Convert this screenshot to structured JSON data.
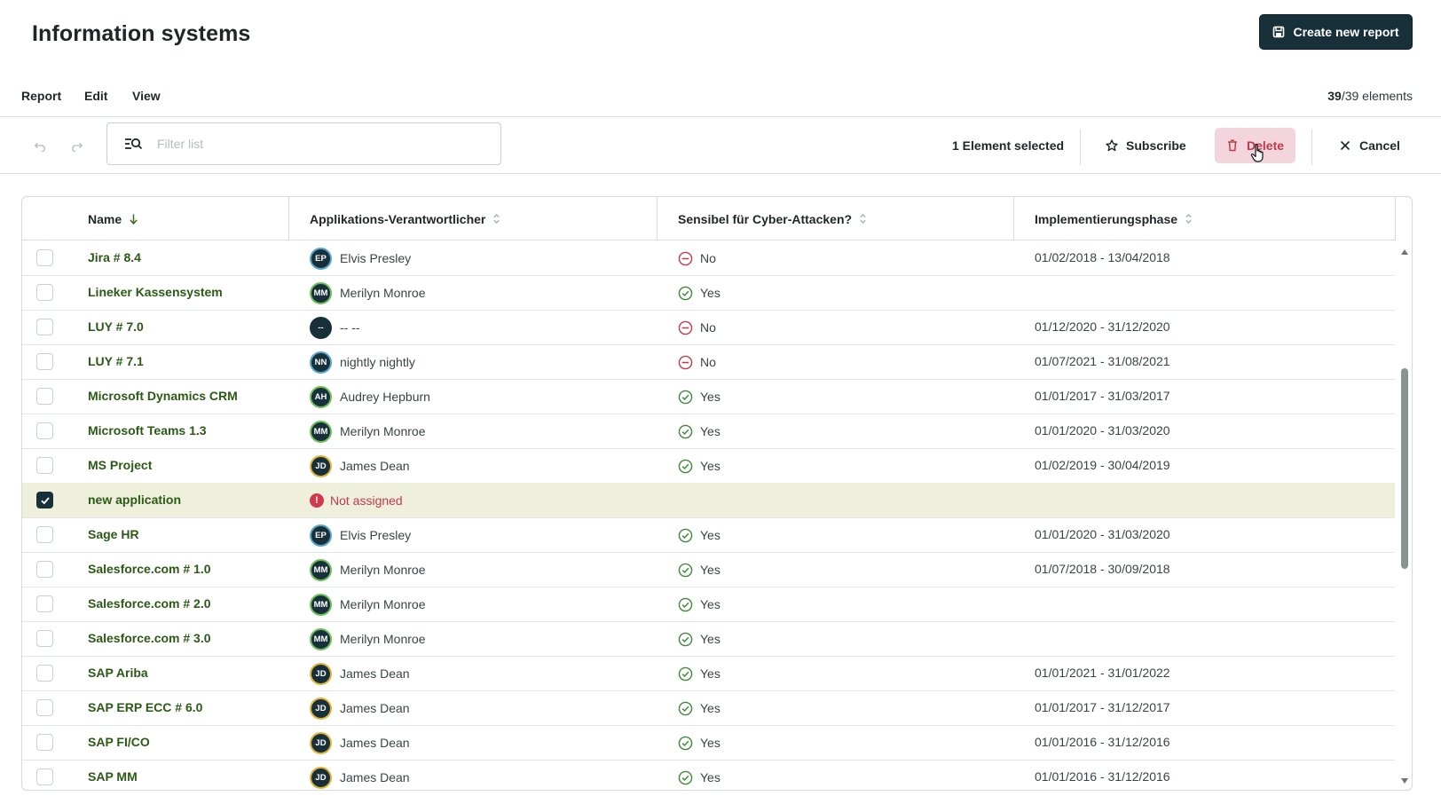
{
  "header": {
    "title": "Information systems",
    "create_label": "Create new report"
  },
  "menu": {
    "report": "Report",
    "edit": "Edit",
    "view": "View",
    "count_shown": "39",
    "count_total": "/39 elements"
  },
  "toolbar": {
    "filter_placeholder": "Filter list",
    "filter_value": "",
    "selection_text": "1 Element selected",
    "subscribe_label": "Subscribe",
    "delete_label": "Delete",
    "cancel_label": "Cancel"
  },
  "table": {
    "columns": {
      "name": "Name",
      "owner": "Applikations-Verantwortlicher",
      "cyber": "Sensibel für Cyber-Attacken?",
      "impl": "Implementierungsphase"
    },
    "sort": {
      "column": "Name",
      "direction": "descending"
    },
    "scroll_position": 0.35,
    "rows": [
      {
        "name": "Jira # 8.4",
        "initials": "EP",
        "owner": "Elvis Presley",
        "cyber": "No",
        "impl": "01/02/2018 - 13/04/2018",
        "selected": false
      },
      {
        "name": "Lineker Kassensystem",
        "initials": "MM",
        "owner": "Merilyn Monroe",
        "cyber": "Yes",
        "impl": "",
        "selected": false
      },
      {
        "name": "LUY # 7.0",
        "initials": "--",
        "owner": "-- --",
        "cyber": "No",
        "impl": "01/12/2020 - 31/12/2020",
        "selected": false
      },
      {
        "name": "LUY # 7.1",
        "initials": "NN",
        "owner": "nightly nightly",
        "cyber": "No",
        "impl": "01/07/2021 - 31/08/2021",
        "selected": false
      },
      {
        "name": "Microsoft Dynamics CRM",
        "initials": "AH",
        "owner": "Audrey Hepburn",
        "cyber": "Yes",
        "impl": "01/01/2017 - 31/03/2017",
        "selected": false
      },
      {
        "name": "Microsoft Teams 1.3",
        "initials": "MM",
        "owner": "Merilyn Monroe",
        "cyber": "Yes",
        "impl": "01/01/2020 - 31/03/2020",
        "selected": false
      },
      {
        "name": "MS Project",
        "initials": "JD",
        "owner": "James Dean",
        "cyber": "Yes",
        "impl": "01/02/2019 - 30/04/2019",
        "selected": false
      },
      {
        "name": "new application",
        "initials": "",
        "owner": "Not assigned",
        "cyber": "",
        "impl": "",
        "selected": true
      },
      {
        "name": "Sage HR",
        "initials": "EP",
        "owner": "Elvis Presley",
        "cyber": "Yes",
        "impl": "01/01/2020 - 31/03/2020",
        "selected": false
      },
      {
        "name": "Salesforce.com # 1.0",
        "initials": "MM",
        "owner": "Merilyn Monroe",
        "cyber": "Yes",
        "impl": "01/07/2018 - 30/09/2018",
        "selected": false
      },
      {
        "name": "Salesforce.com # 2.0",
        "initials": "MM",
        "owner": "Merilyn Monroe",
        "cyber": "Yes",
        "impl": "",
        "selected": false
      },
      {
        "name": "Salesforce.com # 3.0",
        "initials": "MM",
        "owner": "Merilyn Monroe",
        "cyber": "Yes",
        "impl": "",
        "selected": false
      },
      {
        "name": "SAP Ariba",
        "initials": "JD",
        "owner": "James Dean",
        "cyber": "Yes",
        "impl": "01/01/2021 - 31/01/2022",
        "selected": false
      },
      {
        "name": "SAP ERP ECC # 6.0",
        "initials": "JD",
        "owner": "James Dean",
        "cyber": "Yes",
        "impl": "01/01/2017 - 31/12/2017",
        "selected": false
      },
      {
        "name": "SAP FI/CO",
        "initials": "JD",
        "owner": "James Dean",
        "cyber": "Yes",
        "impl": "01/01/2016 - 31/12/2016",
        "selected": false
      },
      {
        "name": "SAP MM",
        "initials": "JD",
        "owner": "James Dean",
        "cyber": "Yes",
        "impl": "01/01/2016 - 31/12/2016",
        "selected": false
      }
    ]
  },
  "colors": {
    "primary": "#17303a",
    "link_green": "#2a5a14",
    "selected_row": "#eef0db",
    "delete_bg": "#f3d6dd",
    "danger": "#c23a4d",
    "yes_green": "#3f8a3a"
  }
}
